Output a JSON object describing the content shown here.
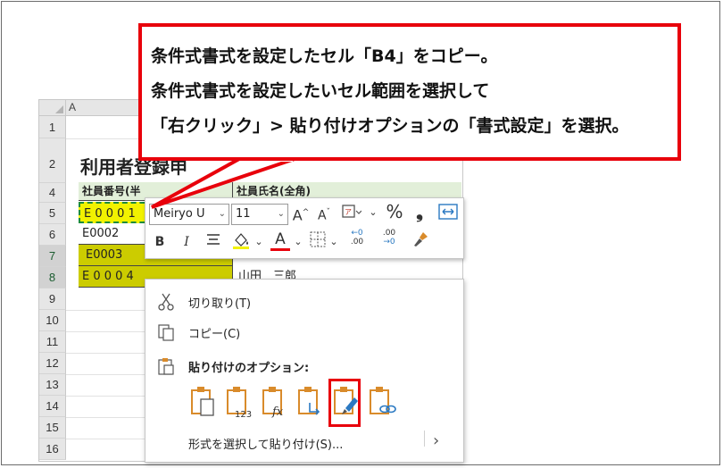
{
  "callout": {
    "line1": "条件式書式を設定したセル「B4」をコピー。",
    "line2": "条件式書式を設定したいセル範囲を選択して",
    "line3": "「右クリック」> 貼り付けオプションの「書式設定」を選択。"
  },
  "sheet": {
    "column_a_header": "A",
    "row_numbers": [
      "1",
      "2",
      "4",
      "5",
      "6",
      "7",
      "8",
      "9",
      "10",
      "11",
      "12",
      "13",
      "14",
      "15",
      "16"
    ],
    "title": "利用者登録申",
    "header_col1": "社員番号(半",
    "header_col2": "社員氏名(全角)",
    "rows": [
      {
        "id": "E 0 0 0 1",
        "name": ""
      },
      {
        "id": "E0002",
        "name": ""
      },
      {
        "id": "E0003",
        "name": ""
      },
      {
        "id": "E 0 0 0 4",
        "name": "山田　三郎"
      }
    ]
  },
  "mini_toolbar": {
    "font_name": "Meiryo U",
    "font_size": "11",
    "bold": "B",
    "italic": "I",
    "grow_font": "A",
    "shrink_font": "A",
    "font_color": "A",
    "percent": "%",
    "comma": "❟",
    "dec_more": ".00",
    "dec_less": ".00"
  },
  "context_menu": {
    "cut": "切り取り(T)",
    "copy": "コピー(C)",
    "paste_options_header": "貼り付けのオプション:",
    "paste_special": "形式を選択して貼り付け(S)...",
    "submenu_arrow": "›",
    "paste_icons": [
      "paste-icon",
      "paste-values-icon",
      "paste-formulas-icon",
      "paste-transpose-icon",
      "paste-formatting-icon",
      "paste-link-icon"
    ]
  },
  "colors": {
    "highlight_red": "#e8000b",
    "yellow_cell": "#cccc00",
    "marquee_green": "#1e8c3c",
    "header_green": "#e2efd9",
    "icon_orange": "#d98b2b",
    "icon_blue": "#2b79c2"
  }
}
